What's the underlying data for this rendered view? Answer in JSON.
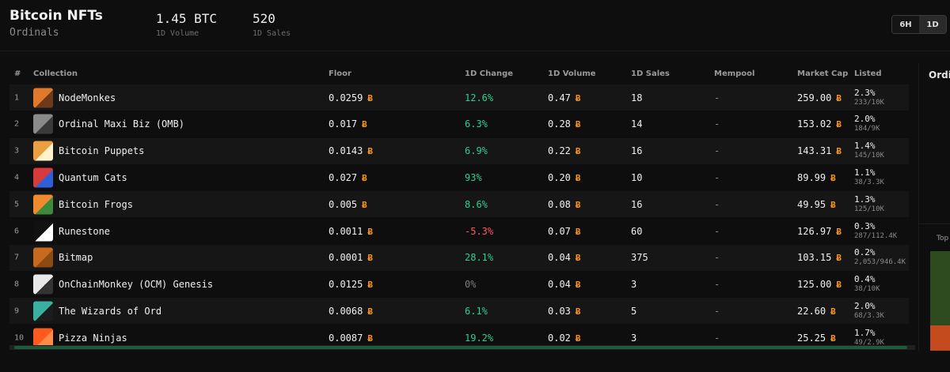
{
  "header": {
    "title": "Bitcoin NFTs",
    "subtitle": "Ordinals",
    "stats": [
      {
        "value": "1.45 BTC",
        "label": "1D Volume"
      },
      {
        "value": "520",
        "label": "1D Sales"
      }
    ],
    "ranges": [
      "6H",
      "1D"
    ],
    "active_range": "1D"
  },
  "table": {
    "columns": [
      "#",
      "Collection",
      "Floor",
      "1D Change",
      "1D Volume",
      "1D Sales",
      "Mempool",
      "Market Cap",
      "Listed"
    ],
    "currency_symbol": "Ƀ",
    "rows": [
      {
        "rank": "1",
        "name": "NodeMonkes",
        "floor": "0.0259",
        "change": "12.6%",
        "change_dir": "pos",
        "volume": "0.47",
        "sales": "18",
        "mempool": "-",
        "mcap": "259.00",
        "listed_pct": "2.3%",
        "listed_cnt": "233/10K",
        "icon": "nodemonkes-thumb-icon"
      },
      {
        "rank": "2",
        "name": "Ordinal Maxi Biz (OMB)",
        "floor": "0.017",
        "change": "6.3%",
        "change_dir": "pos",
        "volume": "0.28",
        "sales": "14",
        "mempool": "-",
        "mcap": "153.02",
        "listed_pct": "2.0%",
        "listed_cnt": "184/9K",
        "icon": "omb-thumb-icon"
      },
      {
        "rank": "3",
        "name": "Bitcoin Puppets",
        "floor": "0.0143",
        "change": "6.9%",
        "change_dir": "pos",
        "volume": "0.22",
        "sales": "16",
        "mempool": "-",
        "mcap": "143.31",
        "listed_pct": "1.4%",
        "listed_cnt": "145/10K",
        "icon": "puppets-thumb-icon"
      },
      {
        "rank": "4",
        "name": "Quantum Cats",
        "floor": "0.027",
        "change": "93%",
        "change_dir": "pos",
        "volume": "0.20",
        "sales": "10",
        "mempool": "-",
        "mcap": "89.99",
        "listed_pct": "1.1%",
        "listed_cnt": "38/3.3K",
        "icon": "quantum-cats-thumb-icon"
      },
      {
        "rank": "5",
        "name": "Bitcoin Frogs",
        "floor": "0.005",
        "change": "8.6%",
        "change_dir": "pos",
        "volume": "0.08",
        "sales": "16",
        "mempool": "-",
        "mcap": "49.95",
        "listed_pct": "1.3%",
        "listed_cnt": "125/10K",
        "icon": "frogs-thumb-icon"
      },
      {
        "rank": "6",
        "name": "Runestone",
        "floor": "0.0011",
        "change": "-5.3%",
        "change_dir": "neg",
        "volume": "0.07",
        "sales": "60",
        "mempool": "-",
        "mcap": "126.97",
        "listed_pct": "0.3%",
        "listed_cnt": "287/112.4K",
        "icon": "runestone-thumb-icon"
      },
      {
        "rank": "7",
        "name": "Bitmap",
        "floor": "0.0001",
        "change": "28.1%",
        "change_dir": "pos",
        "volume": "0.04",
        "sales": "375",
        "mempool": "-",
        "mcap": "103.15",
        "listed_pct": "0.2%",
        "listed_cnt": "2,053/946.4K",
        "icon": "bitmap-thumb-icon"
      },
      {
        "rank": "8",
        "name": "OnChainMonkey (OCM) Genesis",
        "floor": "0.0125",
        "change": "0%",
        "change_dir": "neutral",
        "volume": "0.04",
        "sales": "3",
        "mempool": "-",
        "mcap": "125.00",
        "listed_pct": "0.4%",
        "listed_cnt": "38/10K",
        "icon": "ocm-thumb-icon"
      },
      {
        "rank": "9",
        "name": "The Wizards of Ord",
        "floor": "0.0068",
        "change": "6.1%",
        "change_dir": "pos",
        "volume": "0.03",
        "sales": "5",
        "mempool": "-",
        "mcap": "22.60",
        "listed_pct": "2.0%",
        "listed_cnt": "68/3.3K",
        "icon": "wizards-thumb-icon"
      },
      {
        "rank": "10",
        "name": "Pizza Ninjas",
        "floor": "0.0087",
        "change": "19.2%",
        "change_dir": "pos",
        "volume": "0.02",
        "sales": "3",
        "mempool": "-",
        "mcap": "25.25",
        "listed_pct": "1.7%",
        "listed_cnt": "49/2.9K",
        "icon": "pizza-ninjas-thumb-icon"
      }
    ]
  },
  "side": {
    "title": "Ordi",
    "subtitle": "Top"
  },
  "colors": {
    "positive": "#2fcf8f",
    "negative": "#ff5a5a",
    "btc": "#f7931a",
    "scrollbar": "#1e5a3c"
  }
}
